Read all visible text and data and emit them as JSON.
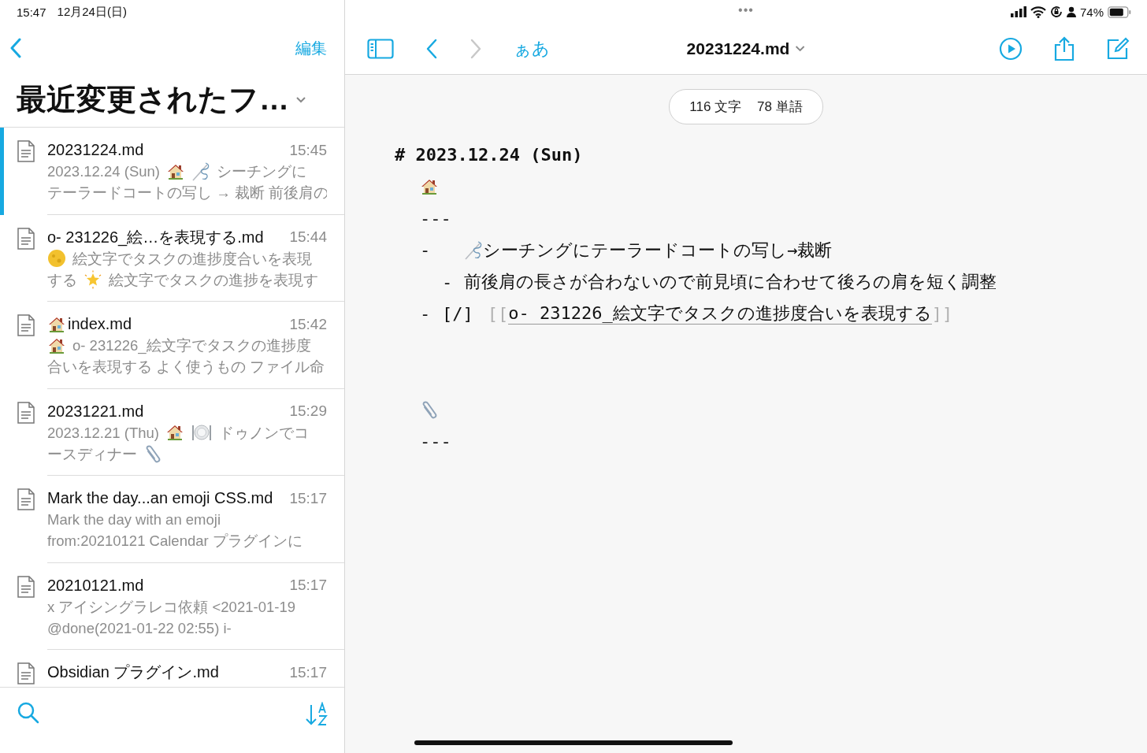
{
  "status_bar": {
    "time": "15:47",
    "date": "12月24日(日)",
    "dots": "•••",
    "battery": "74%"
  },
  "sidebar": {
    "edit_label": "編集",
    "title": "最近変更されたフ…",
    "files": [
      {
        "selected": true,
        "name": [
          {
            "kind": "text",
            "text": "20231224.md"
          }
        ],
        "time": "15:45",
        "preview": [
          [
            {
              "kind": "text",
              "text": "2023.12.24 (Sun)"
            },
            {
              "kind": "house"
            },
            {
              "kind": "needle"
            },
            {
              "kind": "text",
              "text": "シーチングに"
            }
          ],
          [
            {
              "kind": "text",
              "text": "テーラードコートの写し → 裁断 前後肩の"
            }
          ]
        ]
      },
      {
        "selected": false,
        "name": [
          {
            "kind": "text",
            "text": "o- 231226_絵…を表現する.md"
          }
        ],
        "time": "15:44",
        "preview": [
          [
            {
              "kind": "moon"
            },
            {
              "kind": "text",
              "text": "絵文字でタスクの進捗度合いを表現"
            }
          ],
          [
            {
              "kind": "text",
              "text": "する"
            },
            {
              "kind": "star"
            },
            {
              "kind": "text",
              "text": "絵文字でタスクの進捗を表現す"
            }
          ]
        ]
      },
      {
        "selected": false,
        "name": [
          {
            "kind": "house"
          },
          {
            "kind": "text",
            "text": "index.md"
          }
        ],
        "time": "15:42",
        "preview": [
          [
            {
              "kind": "house"
            },
            {
              "kind": "text",
              "text": "o- 231226_絵文字でタスクの進捗度"
            }
          ],
          [
            {
              "kind": "text",
              "text": "合いを表現する よく使うもの ファイル命"
            }
          ]
        ]
      },
      {
        "selected": false,
        "name": [
          {
            "kind": "text",
            "text": "20231221.md"
          }
        ],
        "time": "15:29",
        "preview": [
          [
            {
              "kind": "text",
              "text": "2023.12.21 (Thu)"
            },
            {
              "kind": "house"
            },
            {
              "kind": "plate"
            },
            {
              "kind": "text",
              "text": "ドゥノンでコ"
            }
          ],
          [
            {
              "kind": "text",
              "text": "ースディナー"
            },
            {
              "kind": "paperclip"
            }
          ]
        ]
      },
      {
        "selected": false,
        "name": [
          {
            "kind": "text",
            "text": "Mark the day...an emoji CSS.md"
          }
        ],
        "time": "15:17",
        "preview": [
          [
            {
              "kind": "text",
              "text": "Mark the day with an emoji"
            }
          ],
          [
            {
              "kind": "text",
              "text": "from:20210121 Calendar プラグインに"
            }
          ]
        ]
      },
      {
        "selected": false,
        "name": [
          {
            "kind": "text",
            "text": "20210121.md"
          }
        ],
        "time": "15:17",
        "preview": [
          [
            {
              "kind": "text",
              "text": "x アイシングラレコ依頼 <2021-01-19"
            }
          ],
          [
            {
              "kind": "text",
              "text": "@done(2021-01-22 02:55) i-"
            }
          ]
        ]
      },
      {
        "selected": false,
        "name": [
          {
            "kind": "text",
            "text": "Obsidian プラグイン.md"
          }
        ],
        "time": "15:17"
      }
    ]
  },
  "editor": {
    "font_button": "ぁあ",
    "title": "20231224.md",
    "counts": [
      "116 文字",
      "78 単語"
    ],
    "heading": "# 2023.12.24 (Sun)",
    "lines": [
      {
        "kind": "emoji",
        "segments": [
          {
            "kind": "house"
          }
        ]
      },
      {
        "kind": "rule",
        "text": "---"
      },
      {
        "kind": "bullet",
        "marker": "-",
        "segments": [
          {
            "kind": "needle"
          },
          {
            "kind": "text",
            "text": "シーチングにテーラードコートの写し→裁断"
          }
        ],
        "children": [
          {
            "kind": "bullet",
            "marker": "-",
            "segments": [
              {
                "kind": "text",
                "text": "前後肩の長さが合わないので前見頃に合わせて後ろの肩を短く調整"
              }
            ]
          }
        ]
      },
      {
        "kind": "task",
        "marker": "-",
        "checkbox": "[/]",
        "link_open": "[[",
        "link": "o- 231226_絵文字でタスクの進捗度合いを表現する",
        "link_close": "]]"
      },
      {
        "kind": "blank"
      },
      {
        "kind": "blank"
      },
      {
        "kind": "emoji",
        "segments": [
          {
            "kind": "paperclip"
          }
        ]
      },
      {
        "kind": "rule",
        "text": "---"
      }
    ]
  }
}
